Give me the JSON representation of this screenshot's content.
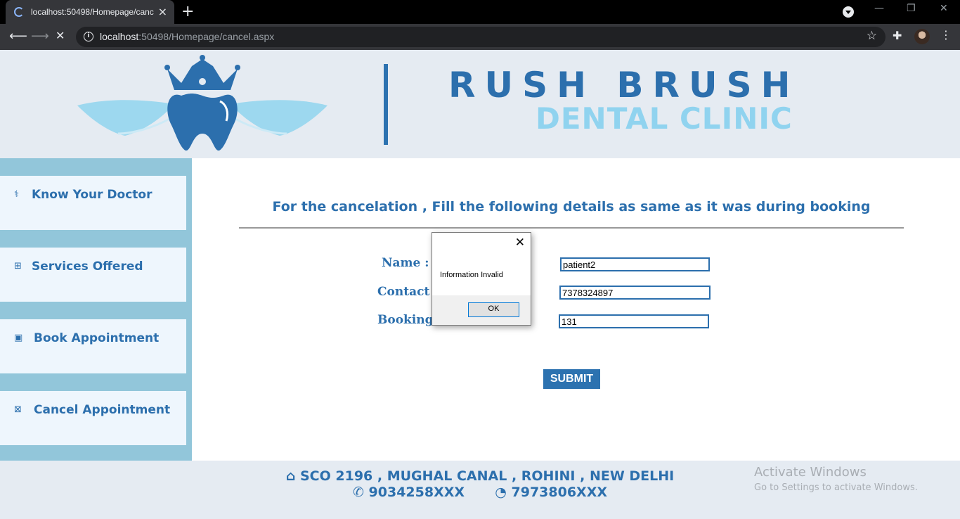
{
  "browser": {
    "tab_title": "localhost:50498/Homepage/canc",
    "tab_close": "×",
    "new_tab": "+",
    "url_host": "localhost",
    "url_rest": ":50498/Homepage/cancel.aspx",
    "window_controls": [
      "—",
      "❐",
      "✕"
    ]
  },
  "header": {
    "brand_line1": "RUSH BRUSH",
    "brand_line2": "DENTAL CLINIC"
  },
  "sidebar": {
    "items": [
      {
        "label": "Know Your Doctor",
        "icon": "doctor-icon"
      },
      {
        "label": "Services Offered",
        "icon": "plus-square-icon"
      },
      {
        "label": "Book Appointment",
        "icon": "calendar-check-icon"
      },
      {
        "label": "Cancel Appointment",
        "icon": "calendar-x-icon"
      }
    ]
  },
  "main": {
    "title": "For the cancelation , Fill the following details as same as it was during booking",
    "name_label": "Name :",
    "contact_label": "Contact N",
    "booking_label": "Booking",
    "name_value": "patient2",
    "contact_value": "7378324897",
    "booking_value": "131",
    "submit_label": "SUBMIT"
  },
  "footer": {
    "address": "SCO 2196 , MUGHAL CANAL , ROHINI , NEW DELHI",
    "phone": "9034258XXX",
    "whatsapp": "7973806XXX"
  },
  "watermark": {
    "line1": "Activate Windows",
    "line2": "Go to Settings to activate Windows."
  },
  "dialog": {
    "message": "Information Invalid",
    "ok_label": "OK"
  },
  "colors": {
    "brand_blue": "#2c6fad",
    "brand_light": "#90d3ef",
    "sidebar_bg": "#92c6da",
    "header_bg": "#e5ebf2"
  }
}
